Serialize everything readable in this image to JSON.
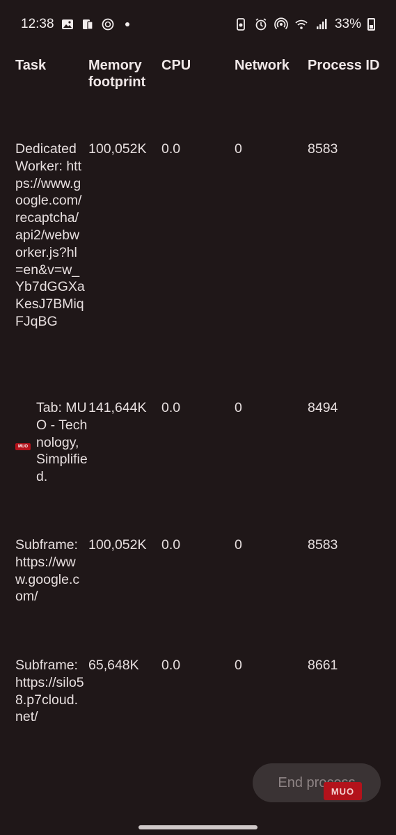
{
  "status_bar": {
    "time": "12:38",
    "battery": "33%",
    "left_icons": [
      "gallery-icon",
      "device-icon",
      "chatgpt-icon"
    ],
    "right_icons": [
      "recycle-icon",
      "alarm-icon",
      "hotspot-icon",
      "wifi-icon",
      "signal-icon",
      "battery-icon"
    ]
  },
  "table": {
    "headers": {
      "task": "Task",
      "memory": "Memory footprint",
      "cpu": "CPU",
      "network": "Network",
      "pid": "Process ID"
    },
    "rows": [
      {
        "task": "Dedicated Worker: https://www.google.com/recaptcha/api2/webworker.js?hl=en&v=w_Yb7dGGXaKesJ7BMiqFJqBG",
        "memory": "100,052K",
        "cpu": "0.0",
        "network": "0",
        "pid": "8583"
      },
      {
        "task": "Tab: MUO - Technology, Simplified.",
        "favicon_text": "MUO",
        "memory": "141,644K",
        "cpu": "0.0",
        "network": "0",
        "pid": "8494"
      },
      {
        "task": "Subframe: https://www.google.com/",
        "memory": "100,052K",
        "cpu": "0.0",
        "network": "0",
        "pid": "8583"
      },
      {
        "task": "Subframe: https://silo58.p7cloud.net/",
        "memory": "65,648K",
        "cpu": "0.0",
        "network": "0",
        "pid": "8661"
      }
    ]
  },
  "end_process_label": "End process",
  "watermark": "MUO"
}
